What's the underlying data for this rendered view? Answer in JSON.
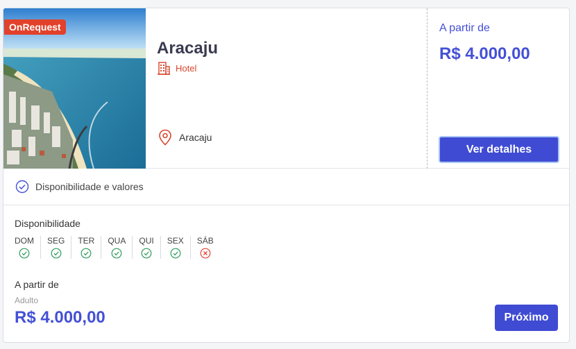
{
  "card": {
    "badge": "OnRequest",
    "title": "Aracaju",
    "type_label": "Hotel",
    "location": "Aracaju",
    "price_from_label": "A partir de",
    "price": "R$ 4.000,00",
    "details_button": "Ver detalhes"
  },
  "availability_header": "Disponibilidade e valores",
  "availability": {
    "title": "Disponibilidade",
    "days": [
      {
        "label": "DOM",
        "available": true
      },
      {
        "label": "SEG",
        "available": true
      },
      {
        "label": "TER",
        "available": true
      },
      {
        "label": "QUA",
        "available": true
      },
      {
        "label": "QUI",
        "available": true
      },
      {
        "label": "SEX",
        "available": true
      },
      {
        "label": "SÁB",
        "available": false
      }
    ],
    "price_from_label": "A partir de",
    "passenger_type": "Adulto",
    "price": "R$ 4.000,00",
    "next_button": "Próximo"
  },
  "colors": {
    "accent": "#3f4bd3",
    "badge": "#e2412b",
    "available": "#2e9a5c",
    "unavailable": "#e0443a"
  }
}
